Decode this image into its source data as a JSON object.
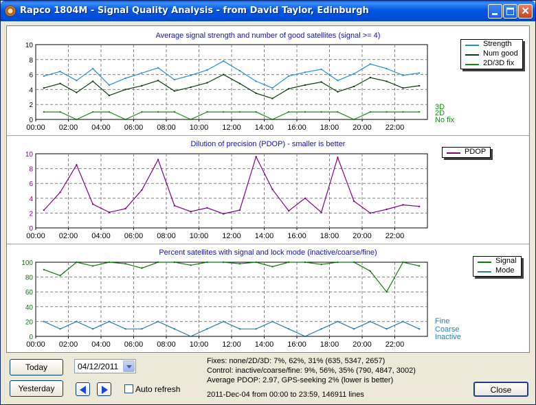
{
  "window": {
    "title": "Rapco 1804M - Signal Quality Analysis - from David Taylor, Edinburgh",
    "icons": {
      "app": "satellite-dish-icon",
      "minimize": "minimize-icon",
      "maximize": "maximize-icon",
      "close": "close-icon",
      "close_glyph": "✕"
    }
  },
  "x_ticks": [
    "00:00",
    "02:00",
    "04:00",
    "06:00",
    "08:00",
    "10:00",
    "12:00",
    "14:00",
    "16:00",
    "18:00",
    "20:00",
    "22:00"
  ],
  "colors": {
    "title_text": "#1010c0",
    "strength": "#1f8fd8",
    "num_good": "#0a3a0a",
    "fix": "#109010",
    "pdop": "#800080",
    "signal": "#0a7a0a",
    "mode": "#2080b0"
  },
  "chart_data": [
    {
      "type": "line",
      "title": "Average signal strength and number of good satellites (signal >= 4)",
      "x_ticks": [
        "00:00",
        "02:00",
        "04:00",
        "06:00",
        "08:00",
        "10:00",
        "12:00",
        "14:00",
        "16:00",
        "18:00",
        "20:00",
        "22:00"
      ],
      "xlim": [
        0,
        24
      ],
      "ylim": [
        0,
        10
      ],
      "y_ticks": [
        0,
        2,
        4,
        6,
        8,
        10
      ],
      "grid": true,
      "legend_position": "top-right",
      "series": [
        {
          "name": "Strength",
          "y": [
            5.8,
            6.4,
            5.2,
            6.8,
            4.6,
            5.5,
            6.2,
            6.9,
            5.3,
            5.9,
            6.6,
            7.8,
            6.5,
            5.1,
            4.2,
            5.8,
            6.3,
            6.7,
            5.2,
            6.1,
            7.4,
            6.8,
            5.9,
            6.2
          ]
        },
        {
          "name": "Num good",
          "y": [
            4.2,
            4.8,
            3.6,
            5.1,
            3.2,
            4.0,
            4.5,
            5.2,
            3.8,
            4.3,
            4.9,
            6.0,
            4.8,
            3.5,
            2.8,
            4.1,
            4.6,
            5.0,
            3.7,
            4.4,
            5.6,
            5.1,
            4.2,
            4.5
          ]
        },
        {
          "name": "2D/3D fix",
          "y": [
            1,
            1,
            0,
            1,
            1,
            0,
            1,
            1,
            1,
            0,
            1,
            1,
            1,
            1,
            0,
            1,
            1,
            1,
            1,
            0,
            1,
            1,
            1,
            1
          ]
        }
      ],
      "level_labels": [
        "3D",
        "2D",
        "No fix"
      ]
    },
    {
      "type": "line",
      "title": "Dilution of precision (PDOP) - smaller is better",
      "x_ticks": [
        "00:00",
        "02:00",
        "04:00",
        "06:00",
        "08:00",
        "10:00",
        "12:00",
        "14:00",
        "16:00",
        "18:00",
        "20:00",
        "22:00"
      ],
      "xlim": [
        0,
        24
      ],
      "ylim": [
        0,
        10
      ],
      "y_ticks": [
        0,
        2,
        4,
        6,
        8,
        10
      ],
      "grid": true,
      "legend_position": "top-right",
      "series": [
        {
          "name": "PDOP",
          "y": [
            2.4,
            4.8,
            8.5,
            3.2,
            2.1,
            2.6,
            5.1,
            9.2,
            3.0,
            2.2,
            2.7,
            1.9,
            2.4,
            9.6,
            5.2,
            2.3,
            4.0,
            2.1,
            9.5,
            3.6,
            2.0,
            2.5,
            3.1,
            2.9
          ]
        }
      ]
    },
    {
      "type": "line",
      "title": "Percent satellites with signal and lock mode (inactive/coarse/fine)",
      "x_ticks": [
        "00:00",
        "02:00",
        "04:00",
        "06:00",
        "08:00",
        "10:00",
        "12:00",
        "14:00",
        "16:00",
        "18:00",
        "20:00",
        "22:00"
      ],
      "xlim": [
        0,
        24
      ],
      "ylim": [
        0,
        100
      ],
      "y_ticks": [
        0,
        20,
        40,
        60,
        80,
        100
      ],
      "grid": true,
      "legend_position": "top-right",
      "series": [
        {
          "name": "Signal",
          "y": [
            90,
            82,
            100,
            95,
            100,
            98,
            92,
            100,
            100,
            96,
            100,
            100,
            98,
            100,
            94,
            100,
            100,
            97,
            100,
            100,
            88,
            60,
            100,
            95
          ]
        },
        {
          "name": "Mode",
          "y": [
            20,
            10,
            20,
            10,
            20,
            10,
            10,
            20,
            10,
            0,
            10,
            20,
            10,
            10,
            20,
            10,
            0,
            10,
            20,
            10,
            20,
            10,
            20,
            10
          ]
        }
      ],
      "level_labels": [
        "Fine",
        "Coarse",
        "Inactive"
      ]
    }
  ],
  "controls": {
    "today_label": "Today",
    "yesterday_label": "Yesterday",
    "date_value": "04/12/2011",
    "auto_refresh_label": "Auto refresh",
    "auto_refresh_checked": false,
    "close_label": "Close",
    "icons": {
      "prev": "arrow-left-icon",
      "next": "arrow-right-icon",
      "dropdown": "chevron-down-icon"
    }
  },
  "stats": {
    "fixes": "Fixes: none/2D/3D:  7%, 62%, 31%  (635, 5347, 2657)",
    "control": "Control: inactive/coarse/fine:  9%, 56%, 35%  (790, 4847, 3002)",
    "pdop": "Average PDOP: 2.97,  GPS-seeking 2% (lower is better)",
    "range": "2011-Dec-04 from 00:00 to 23:59, 146911 lines"
  }
}
